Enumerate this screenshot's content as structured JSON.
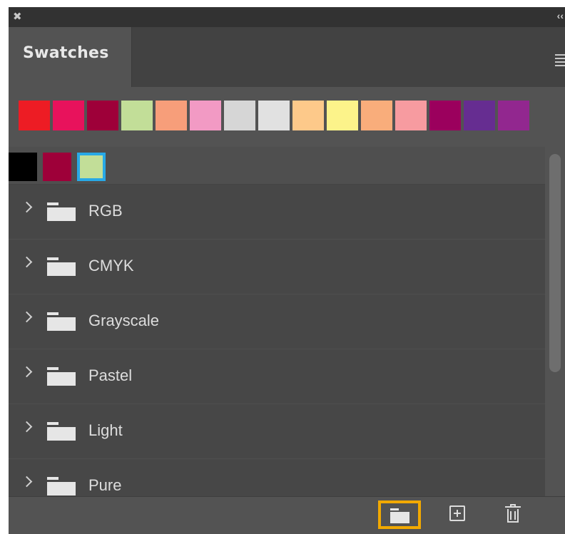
{
  "window": {
    "close_glyph": "✖",
    "collapse_glyph": "‹‹"
  },
  "tabs": [
    {
      "label": "Swatches",
      "active": true
    }
  ],
  "recent_swatches": [
    "#ed1c24",
    "#e8125c",
    "#9e0039",
    "#c2de98",
    "#f79e7a",
    "#f29ac4",
    "#d6d6d6",
    "#e1e1e1",
    "#fdc98a",
    "#fcf38a",
    "#f9ad7b",
    "#f79ba0",
    "#9b005d",
    "#662d91",
    "#92278f"
  ],
  "loose_swatches": [
    {
      "color": "#000000",
      "selected": false
    },
    {
      "color": "#9e0039",
      "selected": false
    },
    {
      "color": "#c2de98",
      "selected": true
    }
  ],
  "colors": {
    "selection": "#28a9e6",
    "highlight": "#f2a900"
  },
  "groups": [
    {
      "label": "RGB",
      "icon": "folder-icon"
    },
    {
      "label": "CMYK",
      "icon": "folder-icon"
    },
    {
      "label": "Grayscale",
      "icon": "folder-icon"
    },
    {
      "label": "Pastel",
      "icon": "folder-icon"
    },
    {
      "label": "Light",
      "icon": "folder-icon"
    },
    {
      "label": "Pure",
      "icon": "folder-icon"
    }
  ],
  "footer_buttons": [
    {
      "name": "create-new-group",
      "icon": "folder-icon",
      "highlighted": true
    },
    {
      "name": "create-new-swatch",
      "icon": "plus-square-icon",
      "highlighted": false
    },
    {
      "name": "delete-swatch",
      "icon": "trash-icon",
      "highlighted": false
    }
  ]
}
